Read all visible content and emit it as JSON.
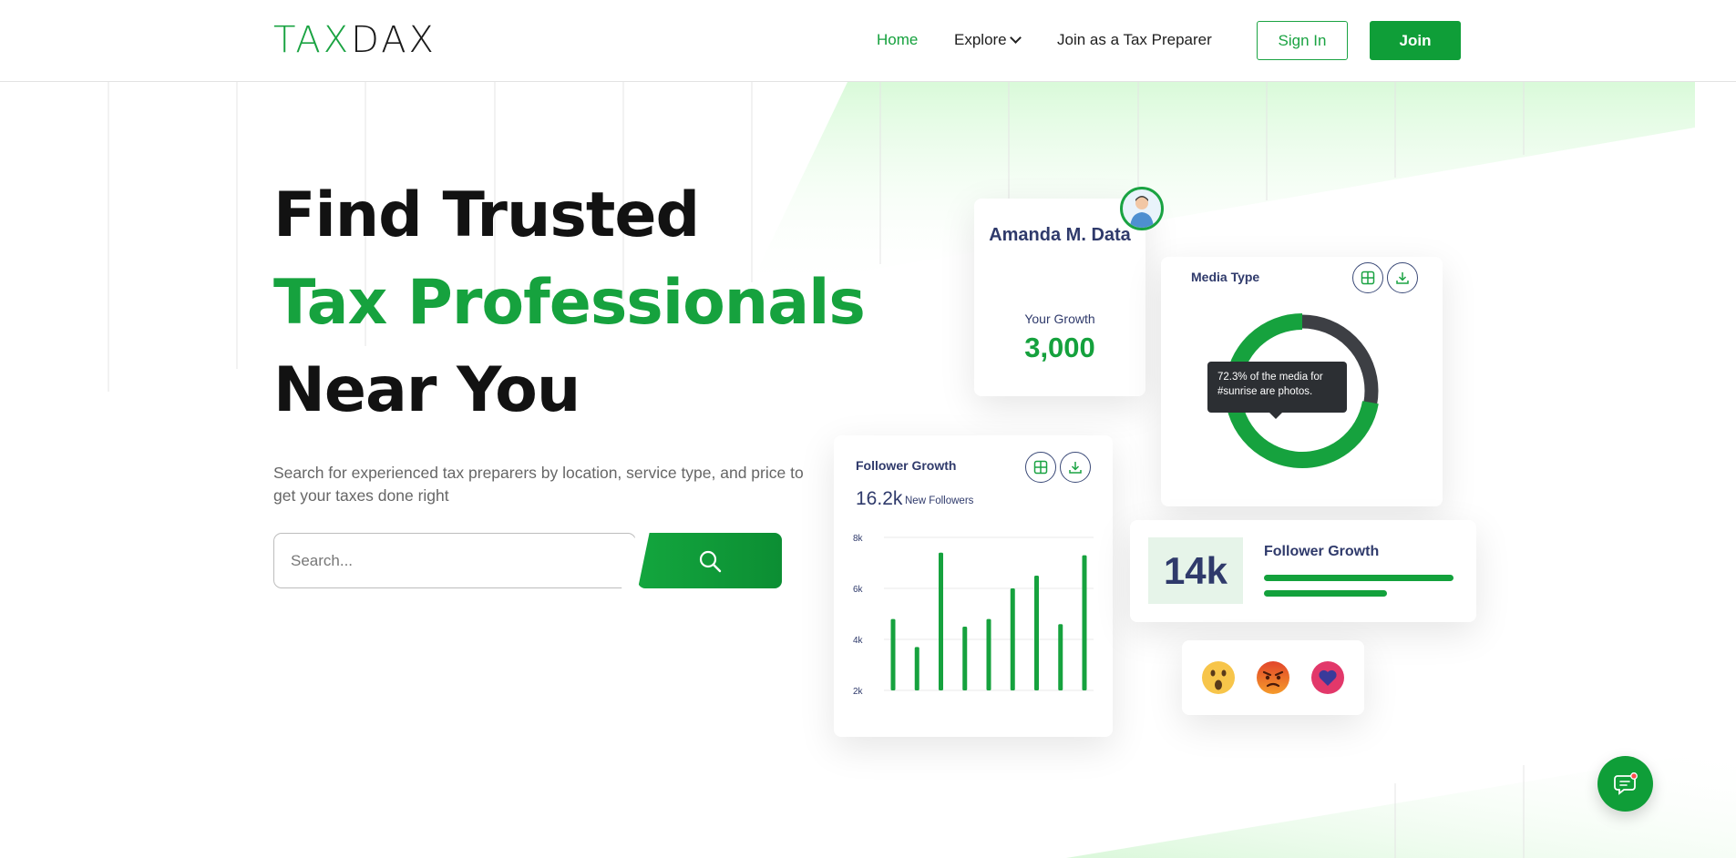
{
  "brand": {
    "logo_part1": "TAX",
    "logo_part2": "DAX"
  },
  "nav": {
    "home": "Home",
    "explore": "Explore",
    "join_preparer": "Join as a Tax Preparer",
    "sign_in": "Sign In",
    "join": "Join"
  },
  "hero": {
    "line1": "Find Trusted",
    "line2": "Tax Professionals",
    "line3": "Near You",
    "subtitle": "Search for experienced tax preparers by location, service type, and price to get your taxes done right",
    "search_placeholder": "Search..."
  },
  "profile_card": {
    "name": "Amanda M. Data",
    "growth_label": "Your Growth",
    "growth_value": "3,000"
  },
  "media_card": {
    "title": "Media Type",
    "tooltip": "72.3% of the media for #sunrise are photos.",
    "donut_green_pct": 72.3
  },
  "follower_card": {
    "title": "Follower Growth",
    "count": "16.2k",
    "count_label": "New Followers"
  },
  "growth_card": {
    "value": "14k",
    "title": "Follower Growth",
    "bar1_fraction": 1.0,
    "bar2_fraction": 0.65
  },
  "reactions": [
    "surprised-emoji",
    "angry-emoji",
    "heart-icon"
  ],
  "colors": {
    "brand_green": "#16a23e",
    "navy": "#2f3a6b",
    "dark_ring": "#3d3f44"
  },
  "chart_data": {
    "type": "bar",
    "ylim": [
      2000,
      8000
    ],
    "ytick_labels": [
      "8k",
      "6k",
      "4k",
      "2k"
    ],
    "ytick_values": [
      8000,
      6000,
      4000,
      2000
    ],
    "values": [
      4800,
      3700,
      7400,
      4500,
      4800,
      6000,
      6500,
      4600,
      7300
    ]
  }
}
